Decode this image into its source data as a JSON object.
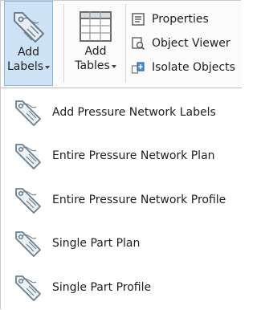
{
  "ribbon": {
    "add_labels": {
      "line1": "Add",
      "line2": "Labels",
      "icon": "tag-icon"
    },
    "add_tables": {
      "line1": "Add",
      "line2": "Tables",
      "icon": "table-icon"
    },
    "small_buttons": [
      {
        "label": "Properties",
        "icon": "properties-icon"
      },
      {
        "label": "Object Viewer",
        "icon": "object-viewer-icon"
      },
      {
        "label": "Isolate Objects",
        "icon": "isolate-objects-icon"
      }
    ],
    "active_color": "#cfe3f6"
  },
  "menu": {
    "items": [
      {
        "label": "Add Pressure Network Labels",
        "icon": "tag-icon"
      },
      {
        "label": "Entire Pressure Network Plan",
        "icon": "tag-icon"
      },
      {
        "label": "Entire Pressure Network Profile",
        "icon": "tag-icon"
      },
      {
        "label": "Single Part Plan",
        "icon": "tag-icon"
      },
      {
        "label": "Single Part Profile",
        "icon": "tag-icon"
      }
    ]
  }
}
